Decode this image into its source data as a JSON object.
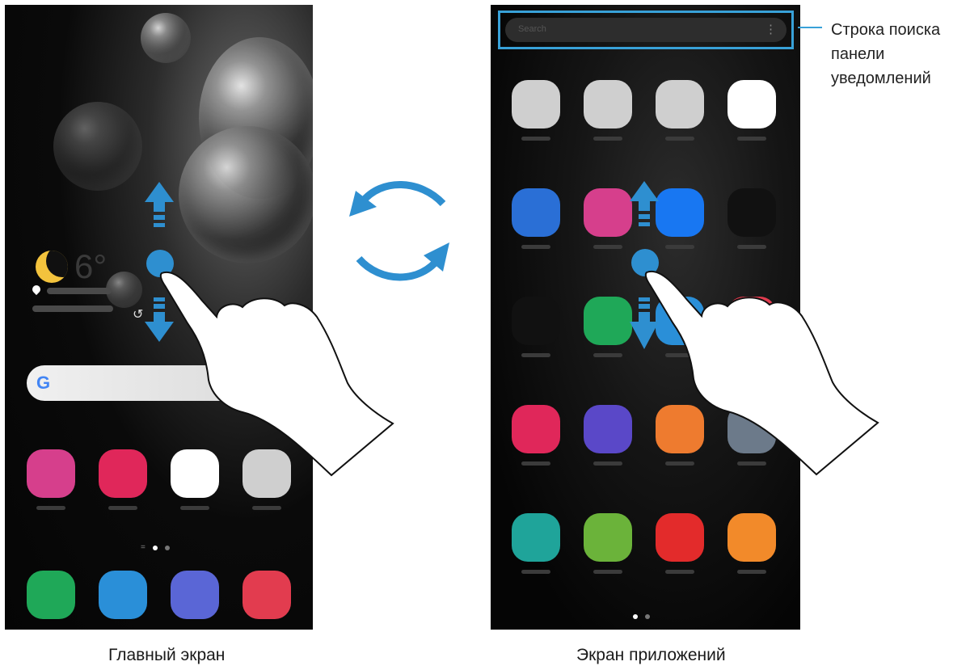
{
  "captions": {
    "home": "Главный экран",
    "apps": "Экран приложений"
  },
  "callout": {
    "lines": [
      "Строка поиска",
      "панели",
      "уведомлений"
    ]
  },
  "home_screen": {
    "google_letter": "G",
    "dock": [
      {
        "name": "phone-icon",
        "color": "#1fa858"
      },
      {
        "name": "messages-icon",
        "color": "#2a8fd8"
      },
      {
        "name": "internet-icon",
        "color": "#5a66d6"
      },
      {
        "name": "camera-icon",
        "color": "#e23c4f"
      }
    ],
    "apps": [
      {
        "name": "galaxy-store-icon",
        "color": "#d63f8c"
      },
      {
        "name": "gallery-icon",
        "color": "#e0275a"
      },
      {
        "name": "play-store-icon",
        "color": "#ffffff"
      },
      {
        "name": "google-folder-icon",
        "color": "#cfcfcf"
      }
    ]
  },
  "apps_screen": {
    "rows": [
      [
        {
          "name": "samsung-folder-icon",
          "color": "#cfcfcf"
        },
        {
          "name": "google-folder-icon",
          "color": "#cfcfcf"
        },
        {
          "name": "microsoft-folder-icon",
          "color": "#cfcfcf"
        },
        {
          "name": "play-store-icon",
          "color": "#ffffff"
        }
      ],
      [
        {
          "name": "samsung-members-icon",
          "color": "#2a6fd6"
        },
        {
          "name": "galaxy-store-icon",
          "color": "#d63f8c"
        },
        {
          "name": "facebook-icon",
          "color": "#1877f2"
        },
        {
          "name": "spotify-icon",
          "color": "#111111"
        }
      ],
      [
        {
          "name": "netflix-icon",
          "color": "#111111"
        },
        {
          "name": "phone-icon",
          "color": "#1fa858"
        },
        {
          "name": "messages-icon",
          "color": "#2a8fd8"
        },
        {
          "name": "app-icon",
          "color": "#e23c4f"
        }
      ],
      [
        {
          "name": "gallery-icon",
          "color": "#e0275a"
        },
        {
          "name": "clock-icon",
          "color": "#5a48c8"
        },
        {
          "name": "contacts-icon",
          "color": "#ee7b2f"
        },
        {
          "name": "settings-icon",
          "color": "#6c7a8a"
        }
      ],
      [
        {
          "name": "calendar-icon",
          "color": "#1fa49a"
        },
        {
          "name": "calculator-icon",
          "color": "#6bb33a"
        },
        {
          "name": "youtube-music-icon",
          "color": "#e32b2b"
        },
        {
          "name": "tips-icon",
          "color": "#f28a2a"
        }
      ]
    ]
  },
  "colors": {
    "accent": "#38a1d8",
    "arrow": "#2e8fd0"
  }
}
